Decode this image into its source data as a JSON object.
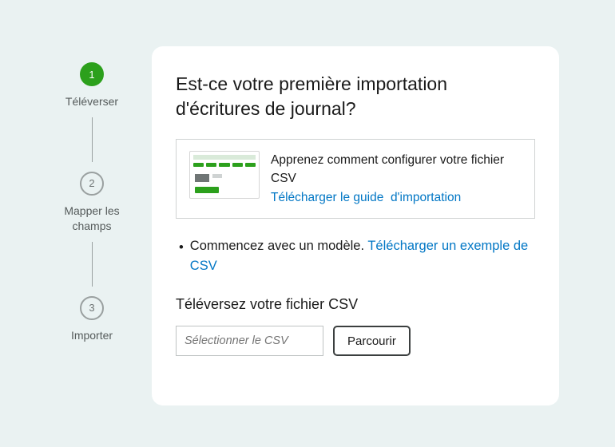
{
  "stepper": {
    "steps": [
      {
        "number": "1",
        "label": "Téléverser",
        "active": true
      },
      {
        "number": "2",
        "label": "Mapper les champs",
        "active": false
      },
      {
        "number": "3",
        "label": "Importer",
        "active": false
      }
    ]
  },
  "card": {
    "title": "Est-ce votre première importation d'écritures de journal?",
    "guide": {
      "description": "Apprenez comment configurer votre fichier CSV",
      "link_label_part1": "Télécharger le guide",
      "link_label_part2": "d'importation"
    },
    "bullet": {
      "text": "Commencez avec un modèle. ",
      "link_label": "Télécharger un exemple de CSV"
    },
    "upload": {
      "heading": "Téléversez votre fichier CSV",
      "placeholder": "Sélectionner le CSV",
      "browse_label": "Parcourir"
    }
  }
}
